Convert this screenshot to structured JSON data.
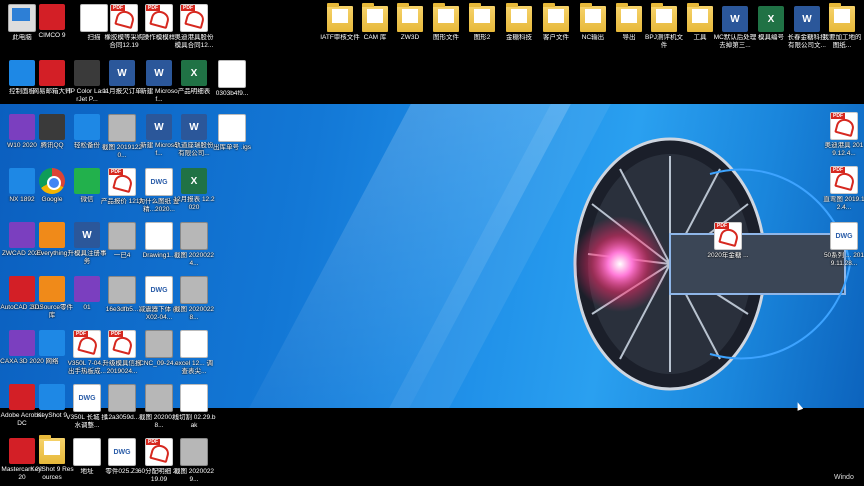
{
  "desktop": {
    "icons": [
      {
        "label": "此电脑",
        "type": "pc"
      },
      {
        "label": "CIMCO 9",
        "type": "red"
      },
      {
        "label": "扫描",
        "type": "doc"
      },
      {
        "label": "橡胶模等采购合同12.19",
        "type": "pdf"
      },
      {
        "label": "操作模模样",
        "type": "pdf"
      },
      {
        "label": "奥迪港具股份模具合同12...",
        "type": "pdf"
      },
      {
        "label": "IATF审核文件",
        "type": "folder"
      },
      {
        "label": "CAM 库",
        "type": "folder"
      },
      {
        "label": "ZW3D",
        "type": "folder"
      },
      {
        "label": "图形文件",
        "type": "folder"
      },
      {
        "label": "图形2",
        "type": "folder"
      },
      {
        "label": "金糖科技",
        "type": "folder"
      },
      {
        "label": "客户文件",
        "type": "folder"
      },
      {
        "label": "NC输出",
        "type": "folder"
      },
      {
        "label": "导出",
        "type": "folder"
      },
      {
        "label": "BPJ测评机文件",
        "type": "folder"
      },
      {
        "label": "工具",
        "type": "folder"
      },
      {
        "label": "MC默认后处理去掉第三...",
        "type": "word"
      },
      {
        "label": "模具编号",
        "type": "excel"
      },
      {
        "label": "长春金糖科技有限公司文...",
        "type": "word"
      },
      {
        "label": "我要加工地的图纸...",
        "type": "folder"
      },
      {
        "label": "控制面板",
        "type": "blue"
      },
      {
        "label": "网易邮箱大师",
        "type": "red"
      },
      {
        "label": "HP Color LaserJet P...",
        "type": "app"
      },
      {
        "label": "11月报欠订单",
        "type": "word"
      },
      {
        "label": "新建 Microsof...",
        "type": "word"
      },
      {
        "label": "产品明细表",
        "type": "excel"
      },
      {
        "label": "0303b4f9...",
        "type": "doc"
      },
      {
        "label": "W10 2020",
        "type": "purple"
      },
      {
        "label": "腾讯QQ",
        "type": "app"
      },
      {
        "label": "轻松备份",
        "type": "blue"
      },
      {
        "label": "截图 20191220...",
        "type": "img"
      },
      {
        "label": "新建 Microsof...",
        "type": "word"
      },
      {
        "label": "轨道座瑞股份有限公司...",
        "type": "word"
      },
      {
        "label": "出库单号 .igs",
        "type": "doc"
      },
      {
        "label": "NX 1892",
        "type": "blue"
      },
      {
        "label": "Google",
        "type": "chrome"
      },
      {
        "label": "微信",
        "type": "green"
      },
      {
        "label": "产品报价 1218",
        "type": "pdf"
      },
      {
        "label": "为什么图纸 金精...2020...",
        "type": "dwg"
      },
      {
        "label": "12月报表 12.2020",
        "type": "excel"
      },
      {
        "label": "ZWCAD 2020",
        "type": "purple"
      },
      {
        "label": "Everything",
        "type": "orange"
      },
      {
        "label": "升模具注册事务",
        "type": "word"
      },
      {
        "label": "一已4",
        "type": "img"
      },
      {
        "label": "Drawing1...",
        "type": "doc"
      },
      {
        "label": "截图 20200224...",
        "type": "img"
      },
      {
        "label": "AutoCAD 2017",
        "type": "red"
      },
      {
        "label": "3DSource零件库",
        "type": "orange"
      },
      {
        "label": "01",
        "type": "purple"
      },
      {
        "label": "16e3dfb5...",
        "type": "img"
      },
      {
        "label": "减震器下体 (KX02-04...",
        "type": "dwg"
      },
      {
        "label": "截图 20200228...",
        "type": "img"
      },
      {
        "label": "CAXA 3D 2020",
        "type": "purple"
      },
      {
        "label": "网络",
        "type": "blue"
      },
      {
        "label": "V350L 7-04... 出手热板成...",
        "type": "pdf"
      },
      {
        "label": "升级模具信报 2019024...",
        "type": "pdf"
      },
      {
        "label": "CNC_09-24...",
        "type": "img"
      },
      {
        "label": "excel 12... 调查表尖...",
        "type": "doc"
      },
      {
        "label": "Adobe Acrobat DC",
        "type": "red"
      },
      {
        "label": "KeyShot 9",
        "type": "blue"
      },
      {
        "label": "V350L 长城 揉水调整...",
        "type": "dwg"
      },
      {
        "label": "12a3059d...",
        "type": "img"
      },
      {
        "label": "截图 20200228...",
        "type": "img"
      },
      {
        "label": "线切割 02.29.bak",
        "type": "doc"
      },
      {
        "label": "Mastercam 2020",
        "type": "red"
      },
      {
        "label": "KeyShot 9 Resources",
        "type": "folder"
      },
      {
        "label": "地址",
        "type": "doc"
      },
      {
        "label": "零件025.Z3",
        "type": "dwg"
      },
      {
        "label": "60分配明细 2019.09",
        "type": "pdf"
      },
      {
        "label": "截图 20200229...",
        "type": "img"
      },
      {
        "label": "2020年金糖 ...",
        "type": "pdf"
      },
      {
        "label": "奥迪港具 2019.12.4...",
        "type": "pdf"
      },
      {
        "label": "直弯图 2019.12.4...",
        "type": "pdf"
      },
      {
        "label": "50系列 ... 2019.11.28...",
        "type": "dwg"
      }
    ],
    "watermark": "Windo"
  }
}
